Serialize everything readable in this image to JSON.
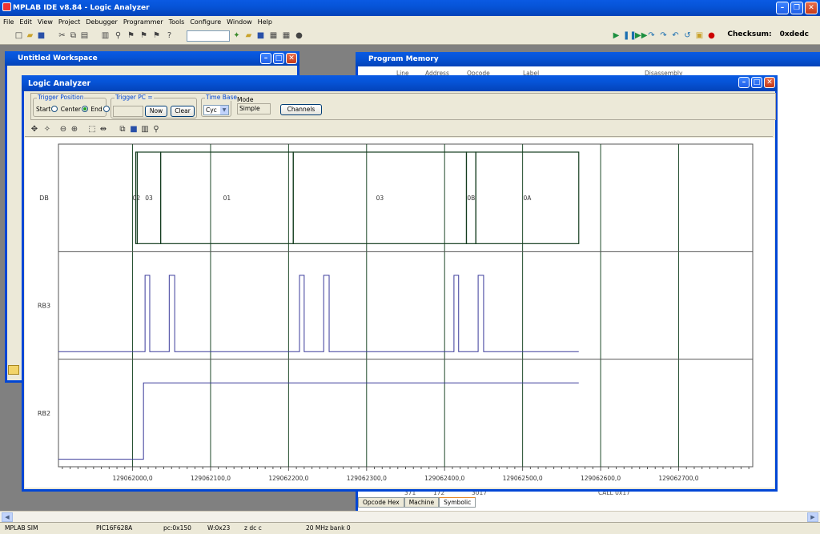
{
  "app": {
    "title": "MPLAB IDE v8.84 - Logic Analyzer",
    "checksum_label": "Checksum:",
    "checksum_value": "0xdedc"
  },
  "menu": [
    "File",
    "Edit",
    "View",
    "Project",
    "Debugger",
    "Programmer",
    "Tools",
    "Configure",
    "Window",
    "Help"
  ],
  "workspace": {
    "title": "Untitled Workspace"
  },
  "program_memory": {
    "title": "Program Memory",
    "columns": [
      "Line",
      "Address",
      "Opcode",
      "Label",
      "Disassembly"
    ],
    "peek_row": [
      "371",
      "172",
      "3017",
      "",
      "CALL 0x17"
    ],
    "tabs": [
      "Opcode Hex",
      "Machine",
      "Symbolic"
    ],
    "active_tab": "Symbolic"
  },
  "logic_analyzer": {
    "title": "Logic Analyzer",
    "trigger_position": {
      "legend": "Trigger Position",
      "options": [
        "Start",
        "Center",
        "End"
      ],
      "selected": "End"
    },
    "trigger_pc": {
      "legend": "Trigger PC =",
      "now_label": "Now",
      "clear_label": "Clear",
      "value": ""
    },
    "time_base": {
      "legend": "Time Base",
      "value": "Cyc"
    },
    "mode": {
      "label": "Mode",
      "value": "Simple"
    },
    "channels_label": "Channels"
  },
  "chart_data": {
    "type": "line",
    "x_ticks": [
      "129062000,0",
      "129062100,0",
      "129062200,0",
      "129062300,0",
      "129062400,0",
      "129062500,0",
      "129062600,0",
      "129062700,0"
    ],
    "xlim": [
      129061905,
      129062795
    ],
    "data_end": 129062572,
    "grid": true,
    "signals": [
      {
        "name": "DB",
        "kind": "bus",
        "segments": [
          {
            "from": 129062004,
            "to": 129062006,
            "label": "02"
          },
          {
            "from": 129062006,
            "to": 129062036,
            "label": "03"
          },
          {
            "from": 129062036,
            "to": 129062206,
            "label": "01"
          },
          {
            "from": 129062206,
            "to": 129062428,
            "label": "03"
          },
          {
            "from": 129062428,
            "to": 129062440,
            "label": "0B"
          },
          {
            "from": 129062440,
            "to": 129062572,
            "label": "0A"
          }
        ]
      },
      {
        "name": "RB3",
        "kind": "digital",
        "initial": 0,
        "transitions": [
          [
            129062016,
            1
          ],
          [
            129062022,
            0
          ],
          [
            129062047,
            1
          ],
          [
            129062054,
            0
          ],
          [
            129062214,
            1
          ],
          [
            129062220,
            0
          ],
          [
            129062245,
            1
          ],
          [
            129062252,
            0
          ],
          [
            129062412,
            1
          ],
          [
            129062418,
            0
          ],
          [
            129062443,
            1
          ],
          [
            129062450,
            0
          ]
        ]
      },
      {
        "name": "RB2",
        "kind": "digital",
        "initial": 0,
        "transitions": [
          [
            129062014,
            1
          ]
        ]
      }
    ]
  },
  "status_bar": {
    "mode": "MPLAB SIM",
    "device": "PIC16F628A",
    "pc": "pc:0x150",
    "w": "W:0x23",
    "flags": "z dc c",
    "freq": "20 MHz",
    "bank": "bank 0"
  }
}
